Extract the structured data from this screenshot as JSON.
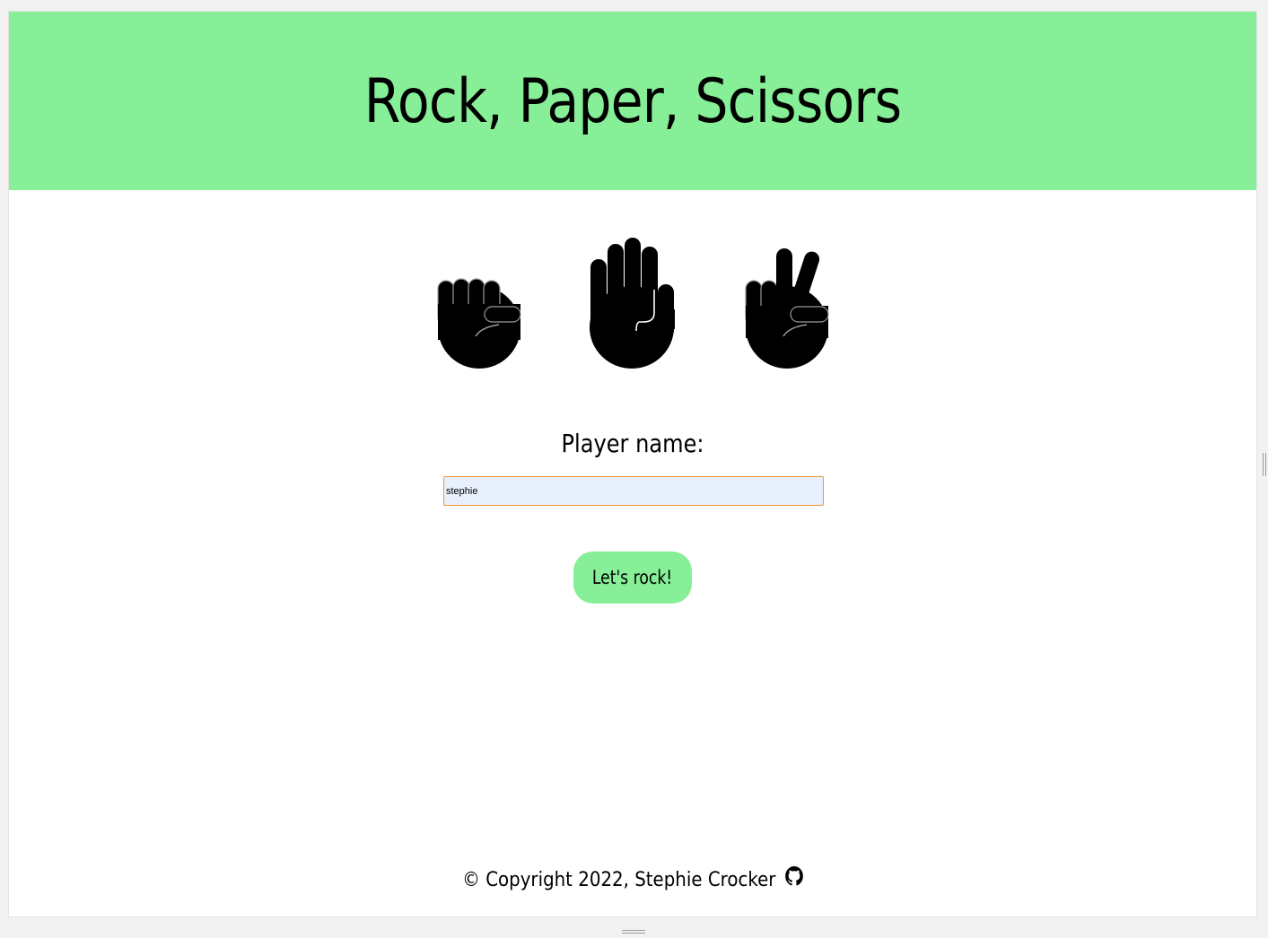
{
  "header": {
    "title": "Rock, Paper, Scissors",
    "background": "#86ef97"
  },
  "choices": [
    {
      "icon": "rock-fist-icon"
    },
    {
      "icon": "paper-hand-icon"
    },
    {
      "icon": "scissors-hand-icon"
    }
  ],
  "form": {
    "label": "Player name:",
    "name_value": "stephie",
    "input_border": "#f0962e",
    "input_fill": "#e8f0fe",
    "submit_label": "Let's rock!",
    "submit_color": "#86ef97"
  },
  "footer": {
    "copyright": "© Copyright 2022, Stephie Crocker",
    "icon": "github-icon"
  }
}
